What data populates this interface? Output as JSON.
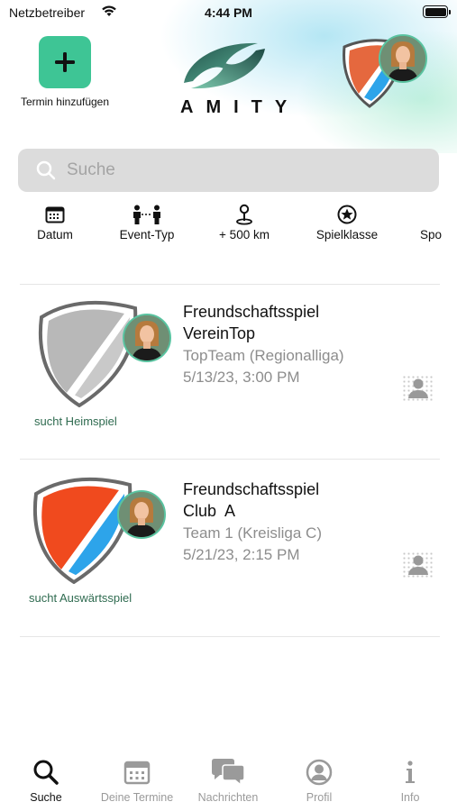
{
  "status_bar": {
    "carrier": "Netzbetreiber",
    "time": "4:44 PM"
  },
  "header": {
    "add_label": "Termin hinzufügen",
    "logo_text": "AMITY"
  },
  "search": {
    "placeholder": "Suche"
  },
  "filters": [
    {
      "label": "Datum",
      "icon": "calendar-icon"
    },
    {
      "label": "Event-Typ",
      "icon": "people-link-icon"
    },
    {
      "label": "+ 500 km",
      "icon": "location-pin-icon"
    },
    {
      "label": "Spielklasse",
      "icon": "star-circle-icon"
    },
    {
      "label": "Spo",
      "icon": "sport-icon"
    }
  ],
  "events": [
    {
      "title_line1": "Freundschaftsspiel",
      "title_line2": "VereinTop",
      "team": "TopTeam (Regionalliga)",
      "datetime": "5/13/23, 3:00 PM",
      "seeking": "sucht Heimspiel",
      "crest_colors": [
        "#b8b8b8",
        "#c9c9c9"
      ]
    },
    {
      "title_line1": "Freundschaftsspiel",
      "title_line2": "Club  A",
      "team": "Team 1 (Kreisliga C)",
      "datetime": "5/21/23, 2:15 PM",
      "seeking": "sucht Auswärtsspiel",
      "crest_colors": [
        "#f04a1e",
        "#2da4ea"
      ]
    }
  ],
  "tabbar": {
    "items": [
      {
        "label": "Suche",
        "icon": "search-icon",
        "active": true
      },
      {
        "label": "Deine Termine",
        "icon": "calendar-icon",
        "active": false
      },
      {
        "label": "Nachrichten",
        "icon": "chat-icon",
        "active": false
      },
      {
        "label": "Profil",
        "icon": "profile-icon",
        "active": false
      },
      {
        "label": "Info",
        "icon": "info-icon",
        "active": false
      }
    ]
  },
  "colors": {
    "accent": "#3ec595",
    "seeking_text": "#2f6b50",
    "muted": "#8d8d8d"
  }
}
